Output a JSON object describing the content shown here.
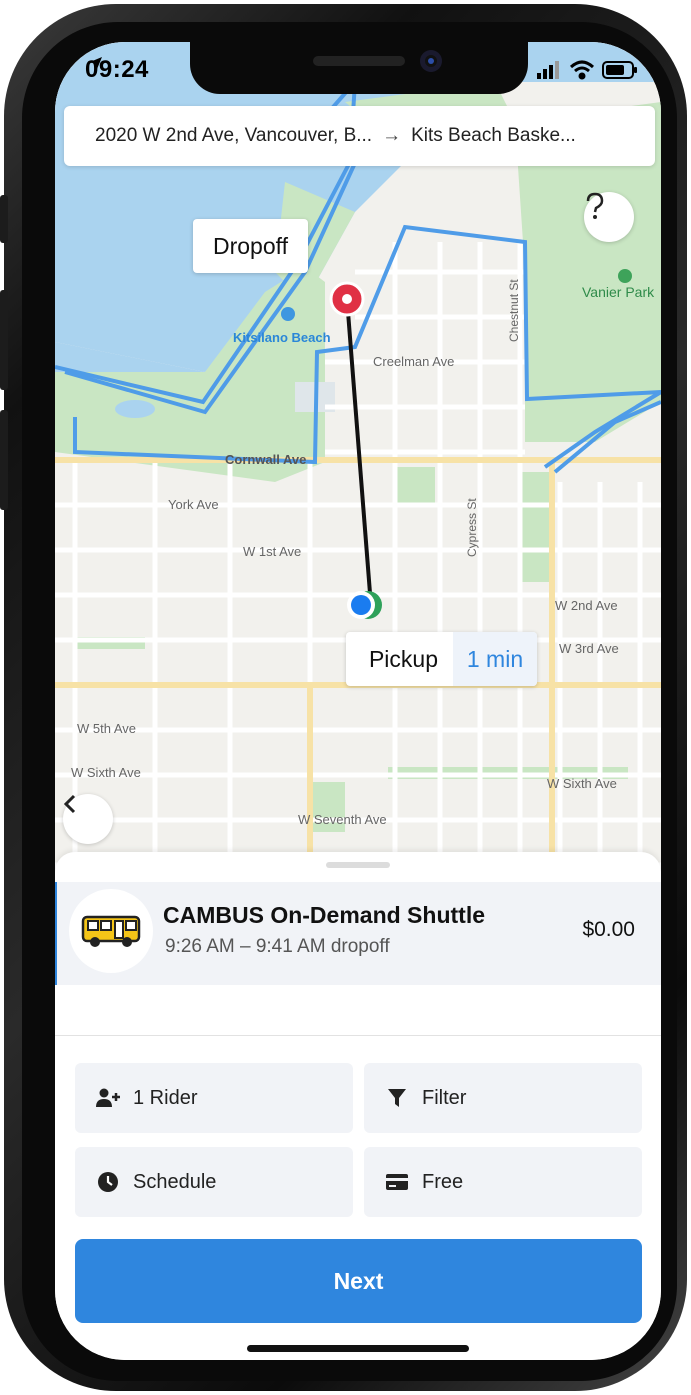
{
  "status_bar": {
    "time": "09:24",
    "icons": [
      "location-arrow-icon",
      "cellular-signal-icon",
      "wifi-icon",
      "battery-icon"
    ]
  },
  "route": {
    "origin": "2020 W 2nd Ave, Vancouver, B...",
    "arrow": "→",
    "destination": "Kits Beach Baske..."
  },
  "map": {
    "street_labels": [
      "Creelman Ave",
      "Chestnut St",
      "Cornwall Ave",
      "York Ave",
      "W 1st Ave",
      "Cypress St",
      "W 2nd Ave",
      "W 3rd Ave",
      "W 5th Ave",
      "W Sixth Ave",
      "W Sixth Ave",
      "W Seventh Ave"
    ],
    "place_labels": [
      "Kitsilano Beach",
      "Vanier Park"
    ],
    "dropoff_label": "Dropoff",
    "pickup_label": "Pickup",
    "pickup_eta": "1 min",
    "colors": {
      "zone_outline": "#4f9ce8",
      "water": "#aad3ef",
      "park": "#c9e6c3",
      "route_line": "#111111",
      "dropoff_pin": "#e03044",
      "pickup_dot": "#1a7cf0"
    }
  },
  "ride_option": {
    "icon": "shuttle-bus-icon",
    "title": "CAMBUS On-Demand Shuttle",
    "time_window": "9:26 AM – 9:41 AM dropoff",
    "price": "$0.00"
  },
  "chips": {
    "riders": {
      "icon": "add-user-icon",
      "label": "1 Rider"
    },
    "filter": {
      "icon": "filter-icon",
      "label": "Filter"
    },
    "schedule": {
      "icon": "clock-icon",
      "label": "Schedule"
    },
    "payment": {
      "icon": "credit-card-icon",
      "label": "Free"
    }
  },
  "next_label": "Next",
  "accent": "#2f86de"
}
